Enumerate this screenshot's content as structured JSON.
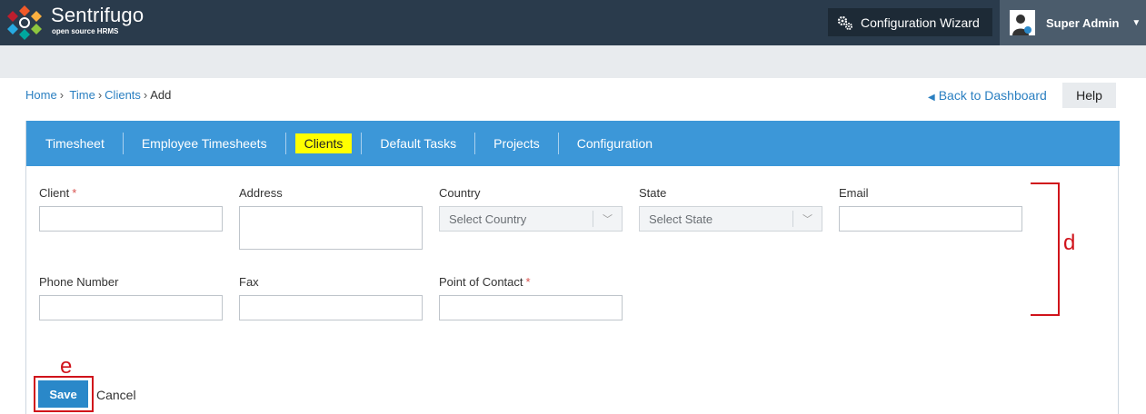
{
  "header": {
    "brand_name": "Sentrifugo",
    "brand_sub": "open source HRMS",
    "wizard_label": "Configuration Wizard",
    "user_name": "Super Admin"
  },
  "breadcrumb": {
    "home": "Home",
    "time": "Time",
    "clients": "Clients",
    "current": "Add"
  },
  "nav": {
    "back_label": "Back to Dashboard",
    "help_label": "Help"
  },
  "tabs": [
    {
      "label": "Timesheet"
    },
    {
      "label": "Employee Timesheets"
    },
    {
      "label": "Clients",
      "active": true
    },
    {
      "label": "Default Tasks"
    },
    {
      "label": "Projects"
    },
    {
      "label": "Configuration"
    }
  ],
  "form": {
    "client_label": "Client",
    "address_label": "Address",
    "country_label": "Country",
    "country_placeholder": "Select Country",
    "state_label": "State",
    "state_placeholder": "Select State",
    "email_label": "Email",
    "phone_label": "Phone Number",
    "fax_label": "Fax",
    "contact_label": "Point of Contact",
    "required_mark": "*",
    "save_label": "Save",
    "cancel_label": "Cancel"
  },
  "annotations": {
    "d": "d",
    "e": "e"
  },
  "colors": {
    "header_bg": "#2a3b4c",
    "tab_bar": "#3c97d8",
    "active_tab_highlight": "#ffff00",
    "link": "#2a7fc1",
    "save_button": "#2a88c9",
    "annotation_red": "#d0131b"
  }
}
